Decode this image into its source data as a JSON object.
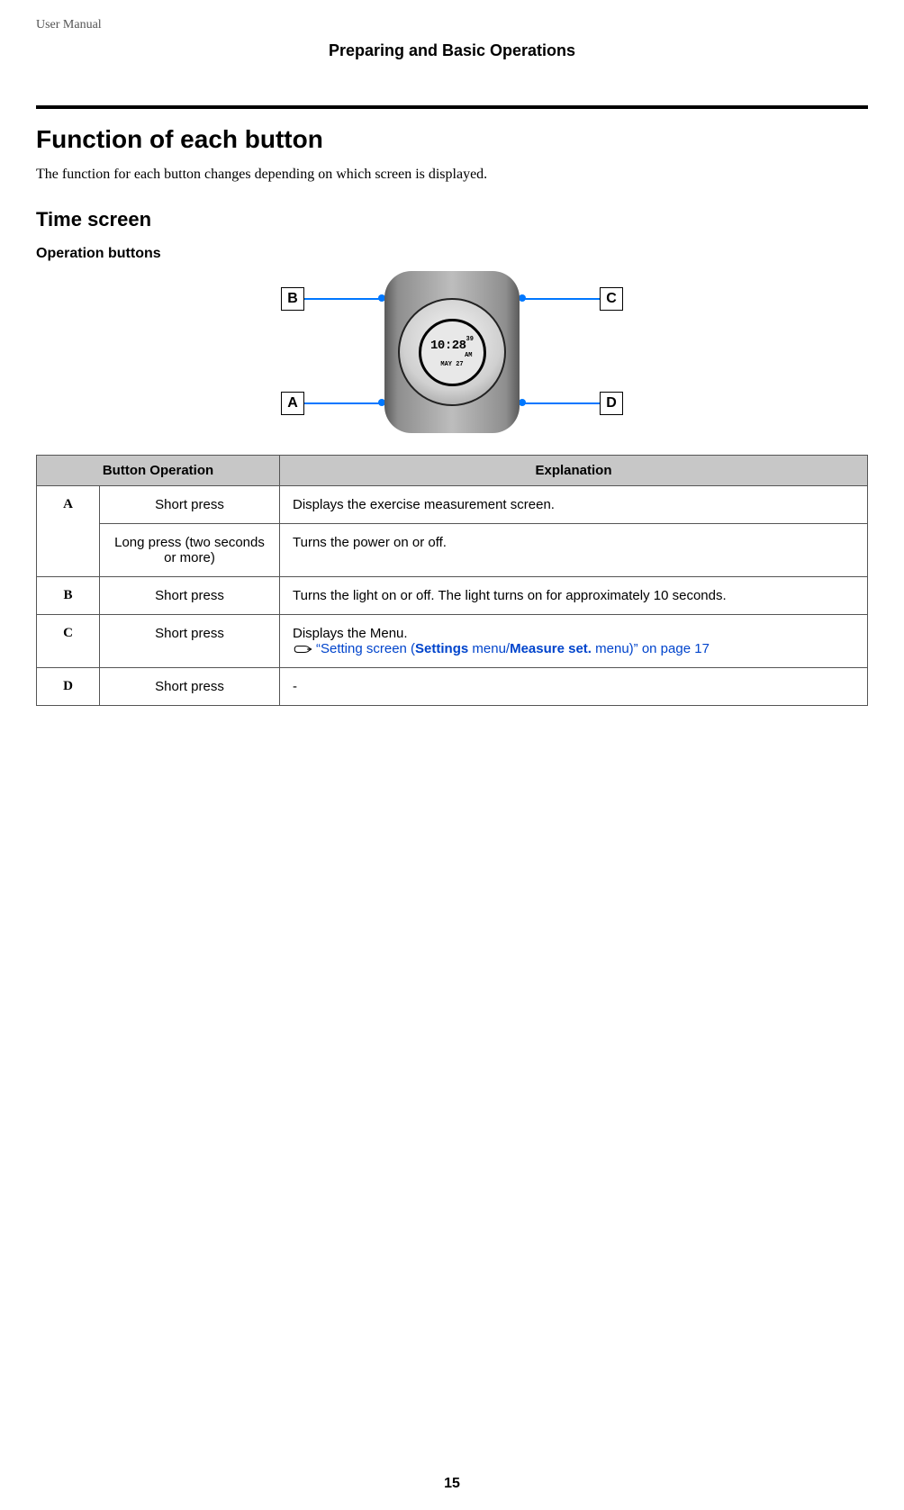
{
  "header": {
    "doc_type": "User Manual",
    "chapter": "Preparing and Basic Operations"
  },
  "section_title": "Function of each button",
  "intro_text": "The function for each button changes depending on which screen is displayed.",
  "subsection_title": "Time screen",
  "subsub_title": "Operation buttons",
  "figure": {
    "labels": {
      "top_left": "B",
      "top_right": "C",
      "bottom_left": "A",
      "bottom_right": "D"
    },
    "watch": {
      "time_main": "10:28",
      "time_sec": "39",
      "ampm": "AM",
      "date": "MAY 27"
    }
  },
  "table": {
    "head_operation": "Button Operation",
    "head_explanation": "Explanation",
    "rows": {
      "A": {
        "id": "A",
        "r1_action": "Short press",
        "r1_expl": "Displays the exercise measurement screen.",
        "r2_action": "Long press (two seconds or more)",
        "r2_expl": "Turns the power on or off."
      },
      "B": {
        "id": "B",
        "action": "Short press",
        "expl": "Turns the light on or off. The light turns on for approximately 10 seconds."
      },
      "C": {
        "id": "C",
        "action": "Short press",
        "expl_line1": "Displays the Menu.",
        "xref_pre": "“Setting screen (",
        "xref_b1": "Settings",
        "xref_mid": " menu/",
        "xref_b2": "Measure set.",
        "xref_post": " menu)” on page 17"
      },
      "D": {
        "id": "D",
        "action": "Short press",
        "expl": "-"
      }
    }
  },
  "page_number": "15"
}
